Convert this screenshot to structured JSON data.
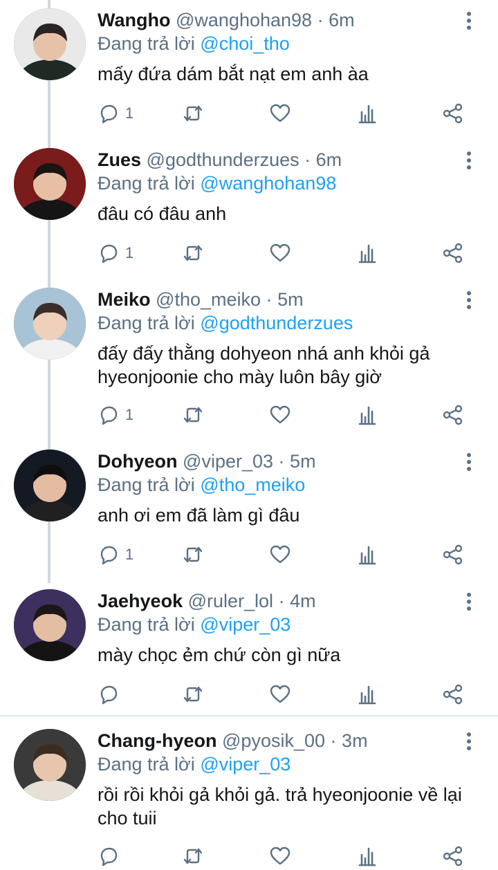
{
  "reply_prefix": "Đang trả lời",
  "tweets": [
    {
      "name": "Wangho",
      "handle": "@wanghohan98",
      "time": "6m",
      "reply_to": "@choi_tho",
      "lines": [
        "mấy đứa dám bắt nạt em anh àa"
      ],
      "reply_count": "1",
      "avatar_colors": {
        "bg": "#e9e9e9",
        "hair": "#2a2424",
        "skin": "#e8c2a8",
        "shirt": "#1f2a24"
      }
    },
    {
      "name": "Zues",
      "handle": "@godthunderzues",
      "time": "6m",
      "reply_to": "@wanghohan98",
      "lines": [
        "đâu có đâu anh"
      ],
      "reply_count": "1",
      "avatar_colors": {
        "bg": "#7a1c1c",
        "hair": "#1a1414",
        "skin": "#e6bfa4",
        "shirt": "#151515"
      }
    },
    {
      "name": "Meiko",
      "handle": "@tho_meiko",
      "time": "5m",
      "reply_to": "@godthunderzues",
      "lines": [
        "đấy đấy thằng dohyeon nhá anh khỏi gả",
        "hyeonjoonie cho mày luôn bây giờ"
      ],
      "reply_count": "1",
      "avatar_colors": {
        "bg": "#a9c3d6",
        "hair": "#3a2e2a",
        "skin": "#efd0bb",
        "shirt": "#f1f1f1"
      }
    },
    {
      "name": "Dohyeon",
      "handle": "@viper_03",
      "time": "5m",
      "reply_to": "@tho_meiko",
      "lines": [
        "anh ơi em đã làm gì đâu"
      ],
      "reply_count": "1",
      "avatar_colors": {
        "bg": "#141a24",
        "hair": "#100e0e",
        "skin": "#e3bca2",
        "shirt": "#202020"
      }
    },
    {
      "name": "Jaehyeok",
      "handle": "@ruler_lol",
      "time": "4m",
      "reply_to": "@viper_03",
      "lines": [
        "mày chọc ẻm chứ còn gì nữa"
      ],
      "reply_count": "",
      "avatar_colors": {
        "bg": "#3d2f5e",
        "hair": "#1c1616",
        "skin": "#e4bea3",
        "shirt": "#141414"
      }
    },
    {
      "name": "Chang-hyeon",
      "handle": "@pyosik_00",
      "time": "3m",
      "reply_to": "@viper_03",
      "lines": [
        "rồi rồi khỏi gả khỏi gả. trả hyeonjoonie về lại",
        "cho tuii"
      ],
      "reply_count": "",
      "avatar_colors": {
        "bg": "#3a3a3a",
        "hair": "#3b2c22",
        "skin": "#e8c6ad",
        "shirt": "#e6e0d6"
      }
    }
  ],
  "icons": {
    "reply": "reply-icon",
    "retweet": "retweet-icon",
    "like": "heart-icon",
    "analytics": "analytics-icon",
    "share": "share-icon",
    "more": "more-icon"
  },
  "colors": {
    "mention": "#1da1f2",
    "muted": "#5b7083",
    "thread_line": "#cfd9de",
    "divider": "#e1e8ed"
  }
}
